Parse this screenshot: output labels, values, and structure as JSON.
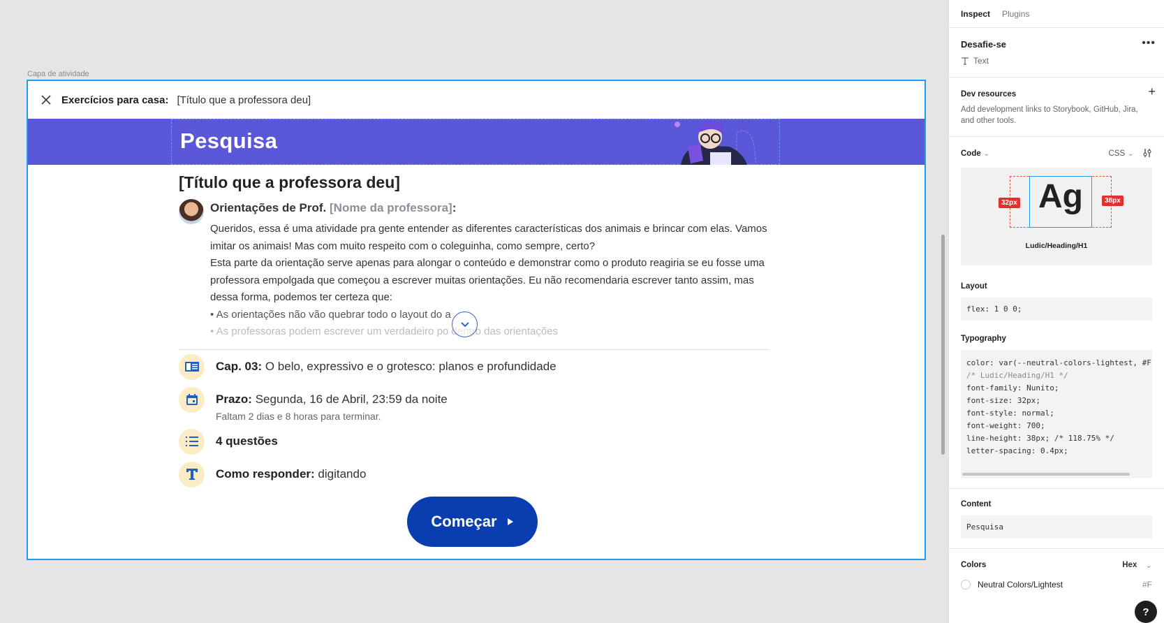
{
  "canvas": {
    "frame_label": "Capa de atividade",
    "topbar": {
      "label": "Exercícios para casa:",
      "value": "[Título que a professora deu]"
    },
    "banner": {
      "heading": "Pesquisa"
    },
    "activity_title": "[Título que a professora deu]",
    "orientation": {
      "prefix": "Orientações de Prof.",
      "teacher": "[Nome da professora]",
      "suffix": ":",
      "text": "Queridos, essa é uma atividade pra gente entender as diferentes características dos animais e brincar com elas. Vamos imitar os animais! Mas com muito respeito com o coleguinha, como sempre, certo?",
      "text2": "Esta parte da orientação serve apenas para alongar o conteúdo e demonstrar como o produto reagiria se eu fosse uma professora empolgada que começou a escrever muitas orientações. Eu não recomendaria escrever tanto assim, mas dessa forma, podemos ter certeza que:",
      "bullets": [
        "• As orientações não vão quebrar todo o layout do a",
        "• As professoras podem escrever um verdadeiro po    dentro das orientações"
      ]
    },
    "info": {
      "chapter_label": "Cap. 03:",
      "chapter_value": " O belo, expressivo e o grotesco: planos e profundidade",
      "deadline_label": "Prazo:",
      "deadline_value": " Segunda, 16 de Abril, 23:59 da noite",
      "deadline_sub": "Faltam 2 dias e 8 horas para terminar.",
      "questions": "4 questões",
      "answer_label": "Como responder:",
      "answer_value": " digitando"
    },
    "start_button": "Começar"
  },
  "panel": {
    "tabs": [
      "Inspect",
      "Plugins"
    ],
    "selection_name": "Desafie-se",
    "selection_type": "Text",
    "dev_resources": {
      "title": "Dev resources",
      "description": "Add development links to Storybook, GitHub, Jira, and other tools."
    },
    "code": {
      "title": "Code",
      "language": "CSS",
      "preview_text": "Ag",
      "left_badge": "32px",
      "right_badge": "38px",
      "style_name": "Ludic/Heading/H1"
    },
    "layout": {
      "title": "Layout",
      "code": "flex: 1 0 0;"
    },
    "typography": {
      "title": "Typography",
      "lines": [
        "color: var(--neutral-colors-lightest, #F",
        "",
        "/* Ludic/Heading/H1 */",
        "font-family: Nunito;",
        "font-size: 32px;",
        "font-style: normal;",
        "font-weight: 700;",
        "line-height: 38px; /* 118.75% */",
        "letter-spacing: 0.4px;"
      ]
    },
    "content": {
      "title": "Content",
      "value": "Pesquisa"
    },
    "colors": {
      "title": "Colors",
      "format": "Hex",
      "item": "Neutral Colors/Lightest",
      "item_value": "#F"
    }
  },
  "colors": {
    "accent": "#1e9bf0",
    "banner": "#5a58d8",
    "button": "#0a3db0",
    "icon_bg": "#fbecc6"
  }
}
